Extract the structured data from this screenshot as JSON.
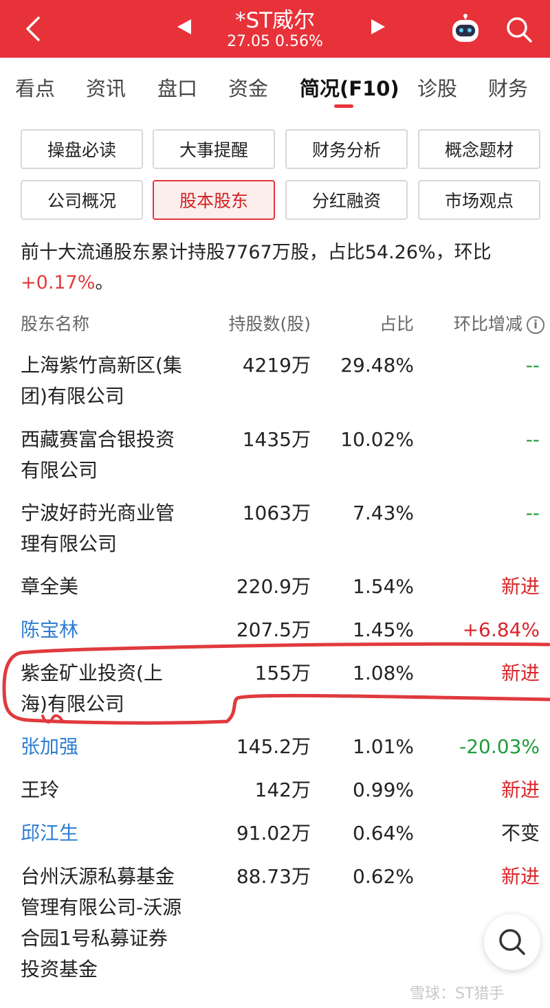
{
  "header": {
    "title": "*ST威尔",
    "subtitle": "27.05 0.56%",
    "bg_color": "#e8323a"
  },
  "tabs": [
    {
      "label": "看点"
    },
    {
      "label": "资讯"
    },
    {
      "label": "盘口"
    },
    {
      "label": "资金"
    },
    {
      "label": "简况(F10)",
      "active": true
    },
    {
      "label": "诊股"
    },
    {
      "label": "财务"
    }
  ],
  "sub_buttons": [
    {
      "label": "操盘必读"
    },
    {
      "label": "大事提醒"
    },
    {
      "label": "财务分析"
    },
    {
      "label": "概念题材"
    },
    {
      "label": "公司概况"
    },
    {
      "label": "股本股东",
      "active": true
    },
    {
      "label": "分红融资"
    },
    {
      "label": "市场观点"
    }
  ],
  "summary": {
    "text": "前十大流通股东累计持股7767万股，占比54.26%，环比",
    "change": "+0.17%",
    "end": "。"
  },
  "table": {
    "headers": {
      "name": "股东名称",
      "shares": "持股数(股)",
      "pct": "占比",
      "change": "环比增减",
      "info_icon": "i"
    },
    "rows": [
      {
        "name": "上海紫竹高新区(集团)有限公司",
        "shares": "4219万",
        "pct": "29.48%",
        "change": "--",
        "change_color": "green"
      },
      {
        "name": "西藏赛富合银投资有限公司",
        "shares": "1435万",
        "pct": "10.02%",
        "change": "--",
        "change_color": "green"
      },
      {
        "name": "宁波好莳光商业管理有限公司",
        "shares": "1063万",
        "pct": "7.43%",
        "change": "--",
        "change_color": "green"
      },
      {
        "name": "章全美",
        "shares": "220.9万",
        "pct": "1.54%",
        "change": "新进",
        "change_color": "red"
      },
      {
        "name": "陈宝林",
        "shares": "207.5万",
        "pct": "1.45%",
        "change": "+6.84%",
        "change_color": "red",
        "name_link": true
      },
      {
        "name": "紫金矿业投资(上海)有限公司",
        "shares": "155万",
        "pct": "1.08%",
        "change": "新进",
        "change_color": "red",
        "highlighted": true
      },
      {
        "name": "张加强",
        "shares": "145.2万",
        "pct": "1.01%",
        "change": "-20.03%",
        "change_color": "green",
        "name_link": true
      },
      {
        "name": "王玲",
        "shares": "142万",
        "pct": "0.99%",
        "change": "新进",
        "change_color": "red"
      },
      {
        "name": "邱江生",
        "shares": "91.02万",
        "pct": "0.64%",
        "change": "不变",
        "change_color": "neutral",
        "name_link": true
      },
      {
        "name": "台州沃源私募基金管理有限公司-沃源合园1号私募证券投资基金",
        "shares": "88.73万",
        "pct": "0.62%",
        "change": "新进",
        "change_color": "red"
      }
    ]
  },
  "watermark": "雪球：ST猎手",
  "icons": [
    "back-arrow-icon",
    "prev-stock-icon",
    "next-stock-icon",
    "robot-assistant-icon",
    "search-icon",
    "info-icon",
    "float-search-icon"
  ]
}
